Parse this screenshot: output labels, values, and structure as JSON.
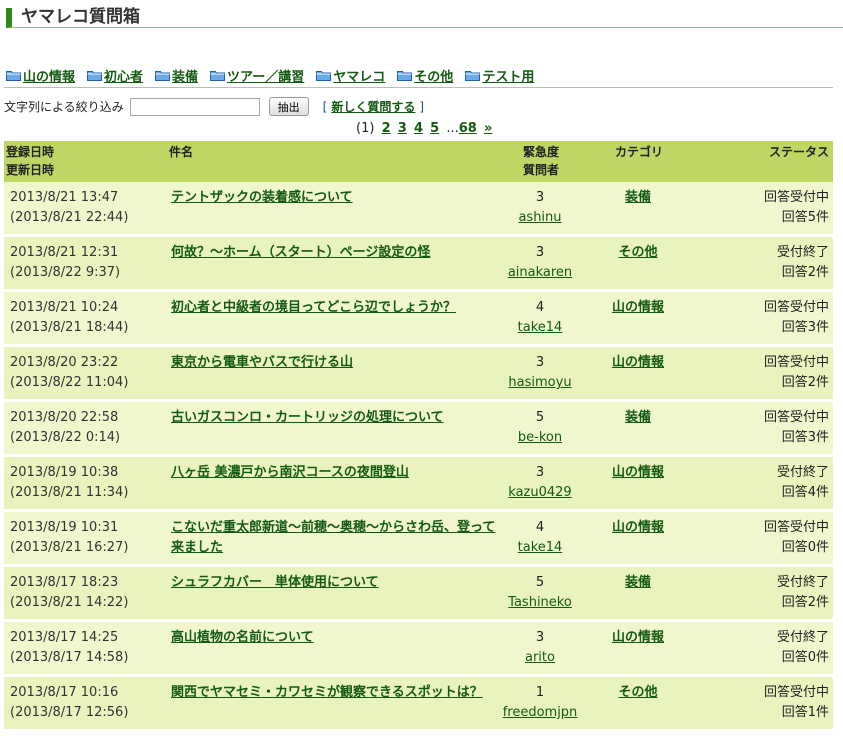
{
  "page": {
    "title": "ヤマレコ質問箱"
  },
  "colors": {
    "link": "#145a12",
    "header_bg": "#bfd665",
    "row_bg": "#f1f7cd",
    "title_bar": "#2f8a17"
  },
  "categories": [
    {
      "label": "山の情報",
      "icon": "folder-icon"
    },
    {
      "label": "初心者",
      "icon": "folder-icon"
    },
    {
      "label": "装備",
      "icon": "folder-icon"
    },
    {
      "label": "ツアー／講習",
      "icon": "folder-icon"
    },
    {
      "label": "ヤマレコ",
      "icon": "folder-icon"
    },
    {
      "label": "その他",
      "icon": "folder-icon"
    },
    {
      "label": "テスト用",
      "icon": "folder-icon"
    }
  ],
  "filter": {
    "label": "文字列による絞り込み",
    "value": "",
    "button": "抽出",
    "bracket_open": "[",
    "new_question": "新しく質問する",
    "bracket_close": "]"
  },
  "pager": {
    "current": "(1)",
    "pages": [
      "2",
      "3",
      "4",
      "5"
    ],
    "ellipsis": "...",
    "last": "68",
    "next": "»"
  },
  "table": {
    "headers": {
      "date1": "登録日時",
      "date2": "更新日時",
      "title": "件名",
      "urgency": "緊急度",
      "asker": "質問者",
      "category": "カテゴリ",
      "status": "ステータス"
    },
    "rows": [
      {
        "created": "2013/8/21 13:47",
        "updated": "(2013/8/21 22:44)",
        "title": "テントザックの装着感について",
        "urgency": "3",
        "asker": "ashinu",
        "category": "装備",
        "status": "回答受付中",
        "answers": "回答5件"
      },
      {
        "created": "2013/8/21 12:31",
        "updated": "(2013/8/22 9:37)",
        "title": "何故？～ホーム（スタート）ページ設定の怪",
        "urgency": "3",
        "asker": "ainakaren",
        "category": "その他",
        "status": "受付終了",
        "answers": "回答2件"
      },
      {
        "created": "2013/8/21 10:24",
        "updated": "(2013/8/21 18:44)",
        "title": "初心者と中級者の境目ってどこら辺でしょうか？",
        "urgency": "4",
        "asker": "take14",
        "category": "山の情報",
        "status": "回答受付中",
        "answers": "回答3件"
      },
      {
        "created": "2013/8/20 23:22",
        "updated": "(2013/8/22 11:04)",
        "title": "東京から電車やバスで行ける山",
        "urgency": "3",
        "asker": "hasimoyu",
        "category": "山の情報",
        "status": "回答受付中",
        "answers": "回答2件"
      },
      {
        "created": "2013/8/20 22:58",
        "updated": "(2013/8/22 0:14)",
        "title": "古いガスコンロ・カートリッジの処理について",
        "urgency": "5",
        "asker": "be-kon",
        "category": "装備",
        "status": "回答受付中",
        "answers": "回答3件"
      },
      {
        "created": "2013/8/19 10:38",
        "updated": "(2013/8/21 11:34)",
        "title": "八ヶ岳 美濃戸から南沢コースの夜間登山",
        "urgency": "3",
        "asker": "kazu0429",
        "category": "山の情報",
        "status": "受付終了",
        "answers": "回答4件"
      },
      {
        "created": "2013/8/19 10:31",
        "updated": "(2013/8/21 16:27)",
        "title": "こないだ重太郎新道～前穂～奥穂～からさわ岳、登って来ました",
        "urgency": "4",
        "asker": "take14",
        "category": "山の情報",
        "status": "回答受付中",
        "answers": "回答0件"
      },
      {
        "created": "2013/8/17 18:23",
        "updated": "(2013/8/21 14:22)",
        "title": "シュラフカバー　単体使用について",
        "urgency": "5",
        "asker": "Tashineko",
        "category": "装備",
        "status": "受付終了",
        "answers": "回答2件"
      },
      {
        "created": "2013/8/17 14:25",
        "updated": "(2013/8/17 14:58)",
        "title": "高山植物の名前について",
        "urgency": "3",
        "asker": "arito",
        "category": "山の情報",
        "status": "受付終了",
        "answers": "回答0件"
      },
      {
        "created": "2013/8/17 10:16",
        "updated": "(2013/8/17 12:56)",
        "title": "関西でヤマセミ・カワセミが観察できるスポットは？",
        "urgency": "1",
        "asker": "freedomjpn",
        "category": "その他",
        "status": "回答受付中",
        "answers": "回答1件"
      }
    ]
  }
}
